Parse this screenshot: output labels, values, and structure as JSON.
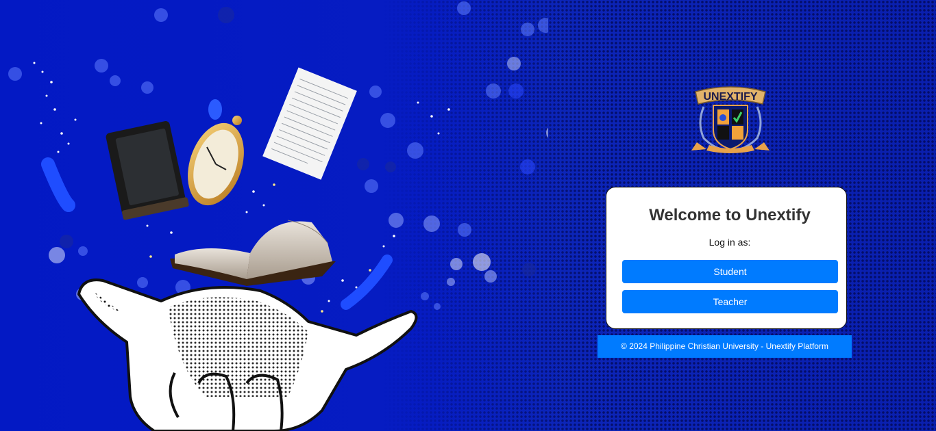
{
  "brand": {
    "logo_text": "UNEXTIFY",
    "colors": {
      "background": "#0a1fc4",
      "accent": "#007bff",
      "card": "#ffffff",
      "title": "#333333"
    }
  },
  "login": {
    "title": "Welcome to Unextify",
    "subtitle": "Log in as:",
    "buttons": {
      "student": "Student",
      "teacher": "Teacher"
    }
  },
  "footer": {
    "text": "© 2024 Philippine Christian University - Unextify Platform"
  },
  "illustration": {
    "icons": [
      "hand-icon",
      "book-icon",
      "pocket-watch-icon",
      "paper-icon",
      "open-book-icon",
      "sparkles-icon"
    ]
  }
}
